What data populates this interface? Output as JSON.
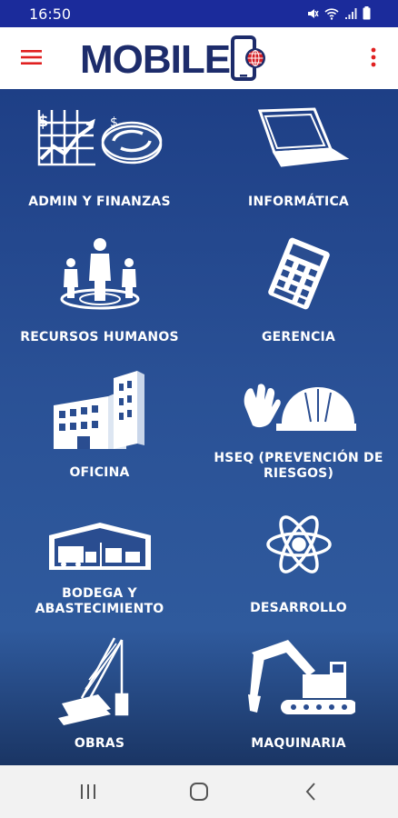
{
  "status_bar": {
    "time": "16:50"
  },
  "app_bar": {
    "logo_text": "MOBILE"
  },
  "tiles": [
    {
      "label": "ADMIN Y FINANZAS",
      "icon": "finance-chart-icon"
    },
    {
      "label": "INFORMÁTICA",
      "icon": "laptop-icon"
    },
    {
      "label": "RECURSOS HUMANOS",
      "icon": "people-icon"
    },
    {
      "label": "GERENCIA",
      "icon": "calculator-icon"
    },
    {
      "label": "OFICINA",
      "icon": "office-building-icon"
    },
    {
      "label": "HSEQ (PREVENCIÓN DE RIESGOS)",
      "icon": "safety-helmet-gloves-icon"
    },
    {
      "label": "BODEGA Y ABASTECIMIENTO",
      "icon": "warehouse-icon"
    },
    {
      "label": "DESARROLLO",
      "icon": "atom-icon"
    },
    {
      "label": "OBRAS",
      "icon": "crane-icon"
    },
    {
      "label": "MAQUINARIA",
      "icon": "excavator-icon"
    }
  ],
  "colors": {
    "status_bar": "#1b2b9b",
    "accent_red": "#e02020",
    "logo_blue": "#1d2c6b",
    "grid_top": "#1e3f86",
    "grid_mid": "#2f5a9d"
  }
}
